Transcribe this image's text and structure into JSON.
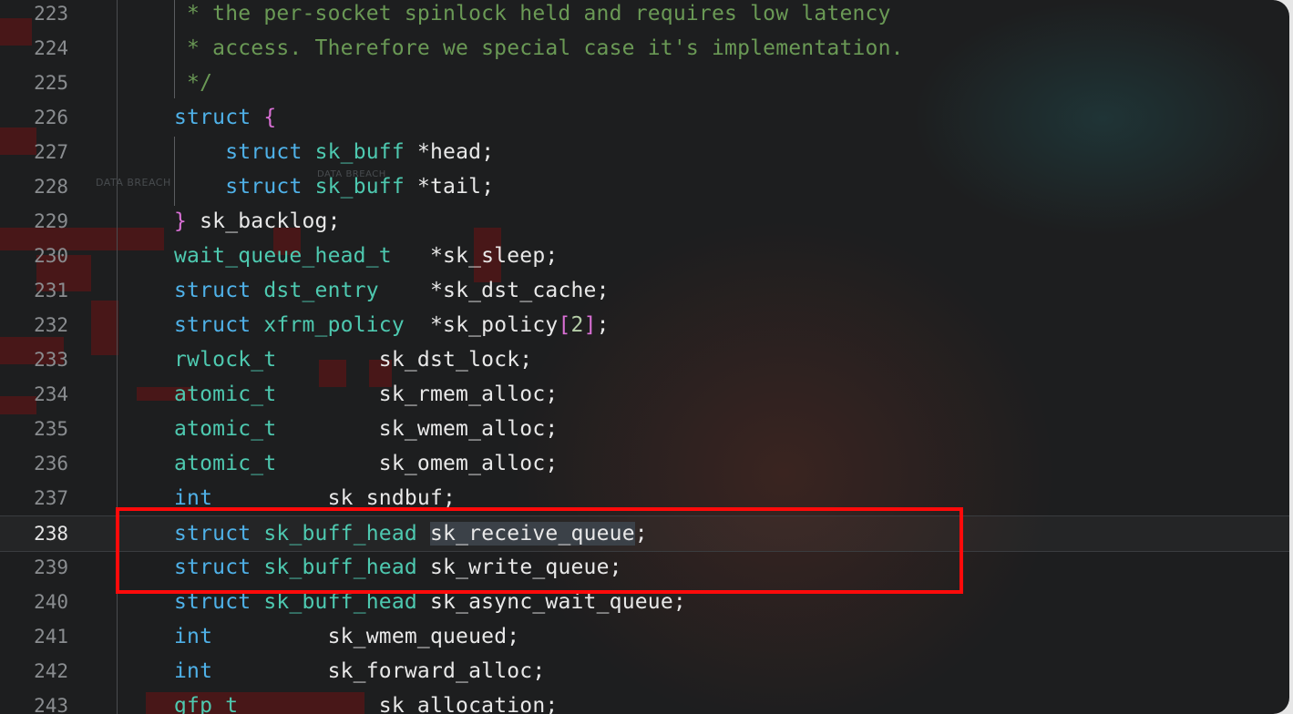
{
  "editor": {
    "lines": [
      {
        "num": "223",
        "tokens": [
          {
            "cls": "c",
            "text": " * the per-socket spinlock held and requires low latency"
          }
        ]
      },
      {
        "num": "224",
        "tokens": [
          {
            "cls": "c",
            "text": " * access. Therefore we special case it's implementation."
          }
        ]
      },
      {
        "num": "225",
        "tokens": [
          {
            "cls": "c",
            "text": " */"
          }
        ]
      },
      {
        "num": "226",
        "tokens": [
          {
            "cls": "k",
            "text": "struct"
          },
          {
            "cls": "v",
            "text": " "
          },
          {
            "cls": "p",
            "text": "{"
          }
        ]
      },
      {
        "num": "227",
        "tokens": [
          {
            "cls": "v",
            "text": "    "
          },
          {
            "cls": "k",
            "text": "struct"
          },
          {
            "cls": "v",
            "text": " "
          },
          {
            "cls": "t",
            "text": "sk_buff"
          },
          {
            "cls": "v",
            "text": " *head;"
          }
        ]
      },
      {
        "num": "228",
        "tokens": [
          {
            "cls": "v",
            "text": "    "
          },
          {
            "cls": "k",
            "text": "struct"
          },
          {
            "cls": "v",
            "text": " "
          },
          {
            "cls": "t",
            "text": "sk_buff"
          },
          {
            "cls": "v",
            "text": " *tail;"
          }
        ]
      },
      {
        "num": "229",
        "tokens": [
          {
            "cls": "p",
            "text": "}"
          },
          {
            "cls": "v",
            "text": " sk_backlog;"
          }
        ]
      },
      {
        "num": "230",
        "tokens": [
          {
            "cls": "t",
            "text": "wait_queue_head_t"
          },
          {
            "cls": "v",
            "text": "   *sk_sleep;"
          }
        ]
      },
      {
        "num": "231",
        "tokens": [
          {
            "cls": "k",
            "text": "struct"
          },
          {
            "cls": "v",
            "text": " "
          },
          {
            "cls": "t",
            "text": "dst_entry"
          },
          {
            "cls": "v",
            "text": "    *sk_dst_cache;"
          }
        ]
      },
      {
        "num": "232",
        "tokens": [
          {
            "cls": "k",
            "text": "struct"
          },
          {
            "cls": "v",
            "text": " "
          },
          {
            "cls": "t",
            "text": "xfrm_policy"
          },
          {
            "cls": "v",
            "text": "  *sk_policy"
          },
          {
            "cls": "p",
            "text": "["
          },
          {
            "cls": "n",
            "text": "2"
          },
          {
            "cls": "p",
            "text": "]"
          },
          {
            "cls": "v",
            "text": ";"
          }
        ]
      },
      {
        "num": "233",
        "tokens": [
          {
            "cls": "t",
            "text": "rwlock_t"
          },
          {
            "cls": "v",
            "text": "        sk_dst_lock;"
          }
        ]
      },
      {
        "num": "234",
        "tokens": [
          {
            "cls": "t",
            "text": "atomic_t"
          },
          {
            "cls": "v",
            "text": "        sk_rmem_alloc;"
          }
        ]
      },
      {
        "num": "235",
        "tokens": [
          {
            "cls": "t",
            "text": "atomic_t"
          },
          {
            "cls": "v",
            "text": "        sk_wmem_alloc;"
          }
        ]
      },
      {
        "num": "236",
        "tokens": [
          {
            "cls": "t",
            "text": "atomic_t"
          },
          {
            "cls": "v",
            "text": "        sk_omem_alloc;"
          }
        ]
      },
      {
        "num": "237",
        "tokens": [
          {
            "cls": "k",
            "text": "int"
          },
          {
            "cls": "v",
            "text": "         sk_sndbuf;"
          }
        ]
      },
      {
        "num": "238",
        "active": true,
        "tokens": [
          {
            "cls": "k",
            "text": "struct"
          },
          {
            "cls": "v",
            "text": " "
          },
          {
            "cls": "t",
            "text": "sk_buff_head"
          },
          {
            "cls": "v",
            "text": " "
          },
          {
            "cls": "v sel",
            "text": "sk_receive_queue"
          },
          {
            "cls": "v",
            "text": ";"
          }
        ]
      },
      {
        "num": "239",
        "tokens": [
          {
            "cls": "k",
            "text": "struct"
          },
          {
            "cls": "v",
            "text": " "
          },
          {
            "cls": "t",
            "text": "sk_buff_head"
          },
          {
            "cls": "v",
            "text": " sk_write_queue;"
          }
        ]
      },
      {
        "num": "240",
        "tokens": [
          {
            "cls": "k",
            "text": "struct"
          },
          {
            "cls": "v",
            "text": " "
          },
          {
            "cls": "t",
            "text": "sk_buff_head"
          },
          {
            "cls": "v",
            "text": " sk_async_wait_queue;"
          }
        ]
      },
      {
        "num": "241",
        "tokens": [
          {
            "cls": "k",
            "text": "int"
          },
          {
            "cls": "v",
            "text": "         sk_wmem_queued;"
          }
        ]
      },
      {
        "num": "242",
        "tokens": [
          {
            "cls": "k",
            "text": "int"
          },
          {
            "cls": "v",
            "text": "         sk_forward_alloc;"
          }
        ]
      },
      {
        "num": "243",
        "tokens": [
          {
            "cls": "t",
            "text": "gfp_t"
          },
          {
            "cls": "v",
            "text": "           sk_allocation;"
          }
        ]
      }
    ]
  },
  "background": {
    "watermarks": [
      "DATA BREACH",
      "DATA BREACH"
    ]
  },
  "colors": {
    "keyword": "#4fb1e8",
    "type": "#4ec9b0",
    "comment": "#6a9955",
    "bracket": "#da70d6",
    "number": "#b5cea8",
    "highlight_box": "#ff0a0a"
  }
}
